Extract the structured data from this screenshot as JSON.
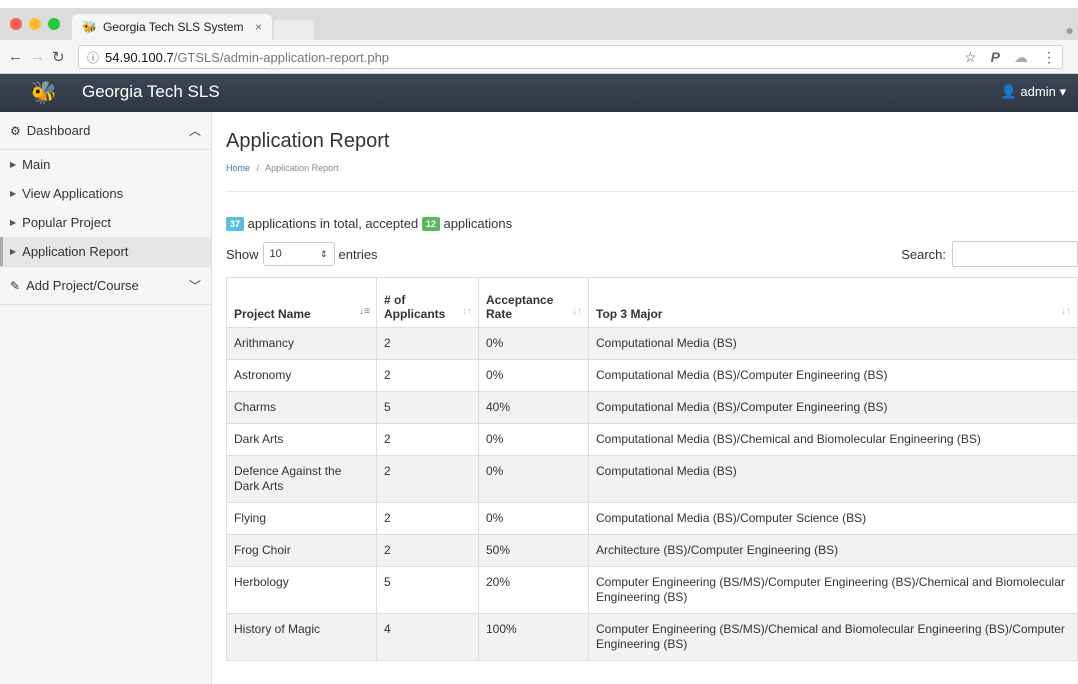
{
  "browser": {
    "tab_title": "Georgia Tech SLS System",
    "tab_close": "×",
    "url_host": "54.90.100.7",
    "url_path": "/GTSLS/admin-application-report.php"
  },
  "navbar": {
    "brand": "Georgia Tech SLS",
    "user": "admin"
  },
  "sidebar": {
    "dashboard": "Dashboard",
    "items": [
      {
        "label": "Main"
      },
      {
        "label": "View Applications"
      },
      {
        "label": "Popular Project"
      },
      {
        "label": "Application Report"
      }
    ],
    "add_project": "Add Project/Course"
  },
  "main": {
    "title": "Application Report",
    "breadcrumb_home": "Home",
    "breadcrumb_sep": "/",
    "breadcrumb_current": "Application Report",
    "total_count": "37",
    "summary_mid": "applications in total, accepted",
    "accepted_count": "12",
    "summary_end": "applications",
    "show_label": "Show",
    "entries_value": "10",
    "entries_label": "entries",
    "search_label": "Search:"
  },
  "table": {
    "headers": [
      "Project Name",
      "# of Applicants",
      "Acceptance Rate",
      "Top 3 Major"
    ],
    "rows": [
      [
        "Arithmancy",
        "2",
        "0%",
        "Computational Media (BS)"
      ],
      [
        "Astronomy",
        "2",
        "0%",
        "Computational Media (BS)/Computer Engineering (BS)"
      ],
      [
        "Charms",
        "5",
        "40%",
        "Computational Media (BS)/Computer Engineering (BS)"
      ],
      [
        "Dark Arts",
        "2",
        "0%",
        "Computational Media (BS)/Chemical and Biomolecular Engineering (BS)"
      ],
      [
        "Defence Against the Dark Arts",
        "2",
        "0%",
        "Computational Media (BS)"
      ],
      [
        "Flying",
        "2",
        "0%",
        "Computational Media (BS)/Computer Science (BS)"
      ],
      [
        "Frog Choir",
        "2",
        "50%",
        "Architecture (BS)/Computer Engineering (BS)"
      ],
      [
        "Herbology",
        "5",
        "20%",
        "Computer Engineering (BS/MS)/Computer Engineering (BS)/Chemical and Biomolecular Engineering (BS)"
      ],
      [
        "History of Magic",
        "4",
        "100%",
        "Computer Engineering (BS/MS)/Chemical and Biomolecular Engineering (BS)/Computer Engineering (BS)"
      ]
    ]
  }
}
